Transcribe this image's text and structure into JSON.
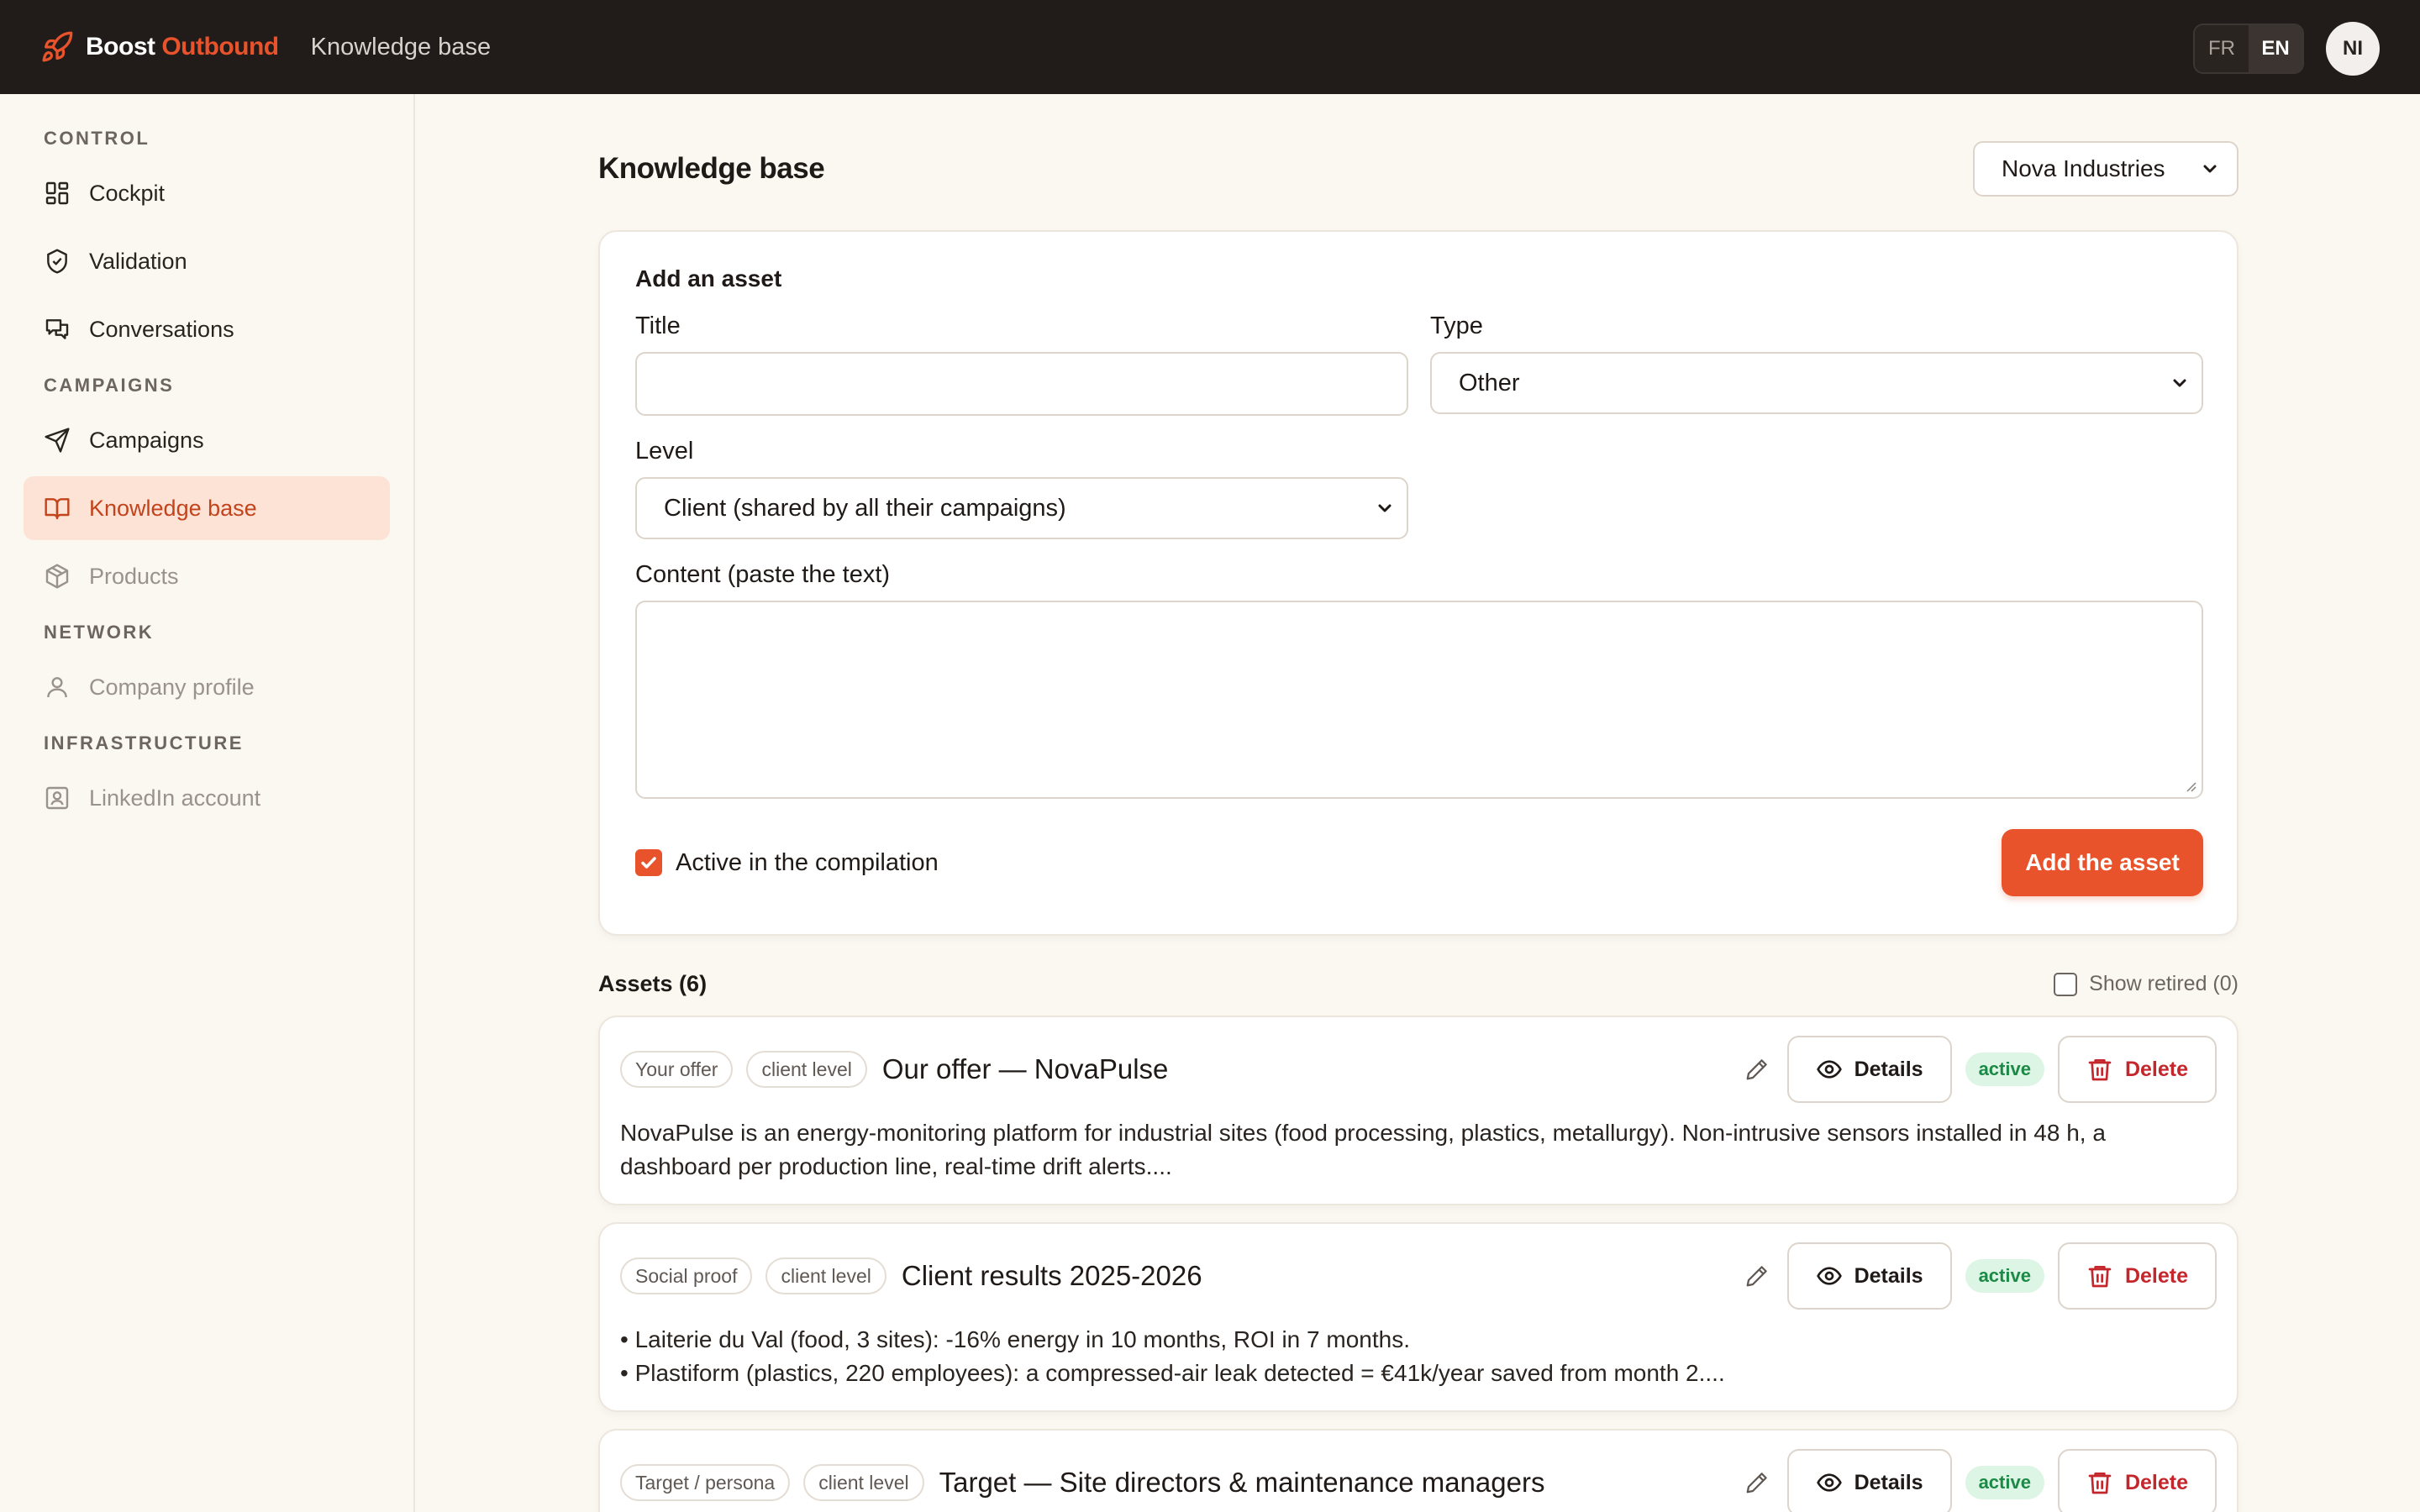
{
  "app": {
    "brand_primary": "Boost",
    "brand_accent": "Outbound",
    "crumb": "Knowledge base",
    "brand_color": "#e8532b",
    "languages": [
      {
        "label": "FR",
        "active": false
      },
      {
        "label": "EN",
        "active": true
      }
    ],
    "avatar_initials": "NI"
  },
  "sidebar": {
    "sections": [
      {
        "label": "CONTROL",
        "items": [
          {
            "label": "Cockpit",
            "icon": "dashboard-icon",
            "state": "normal"
          },
          {
            "label": "Validation",
            "icon": "shield-check-icon",
            "state": "normal"
          },
          {
            "label": "Conversations",
            "icon": "chat-bubbles-icon",
            "state": "normal"
          }
        ]
      },
      {
        "label": "CAMPAIGNS",
        "items": [
          {
            "label": "Campaigns",
            "icon": "send-icon",
            "state": "normal"
          },
          {
            "label": "Knowledge base",
            "icon": "book-open-icon",
            "state": "active"
          },
          {
            "label": "Products",
            "icon": "box-icon",
            "state": "muted"
          }
        ]
      },
      {
        "label": "NETWORK",
        "items": [
          {
            "label": "Company profile",
            "icon": "user-icon",
            "state": "muted"
          }
        ]
      },
      {
        "label": "INFRASTRUCTURE",
        "items": [
          {
            "label": "LinkedIn account",
            "icon": "id-badge-icon",
            "state": "muted"
          }
        ]
      }
    ]
  },
  "main": {
    "title": "Knowledge base",
    "client_select": "Nova Industries",
    "add_form": {
      "heading": "Add an asset",
      "title_label": "Title",
      "title_value": "",
      "type_label": "Type",
      "type_value": "Other",
      "level_label": "Level",
      "level_value": "Client (shared by all their campaigns)",
      "content_label": "Content (paste the text)",
      "content_value": "",
      "active_label": "Active in the compilation",
      "active_checked": true,
      "submit_label": "Add the asset"
    },
    "assets_heading": "Assets (6)",
    "show_retired_label": "Show retired (0)",
    "details_label": "Details",
    "delete_label": "Delete",
    "assets": [
      {
        "type_tag": "Your offer",
        "level_tag": "client level",
        "title": "Our offer — NovaPulse",
        "status": "active",
        "body_lines": [
          "NovaPulse is an energy-monitoring platform for industrial sites (food processing, plastics, metallurgy). Non-intrusive sensors installed in 48 h, a dashboard per production line, real-time drift alerts...."
        ]
      },
      {
        "type_tag": "Social proof",
        "level_tag": "client level",
        "title": "Client results 2025-2026",
        "status": "active",
        "body_lines": [
          "• Laiterie du Val (food, 3 sites): -16% energy in 10 months, ROI in 7 months.",
          "• Plastiform (plastics, 220 employees): a compressed-air leak detected = €41k/year saved from month 2...."
        ]
      },
      {
        "type_tag": "Target / persona",
        "level_tag": "client level",
        "title": "Target — Site directors & maintenance managers",
        "status": "active",
        "body_lines": []
      }
    ]
  }
}
